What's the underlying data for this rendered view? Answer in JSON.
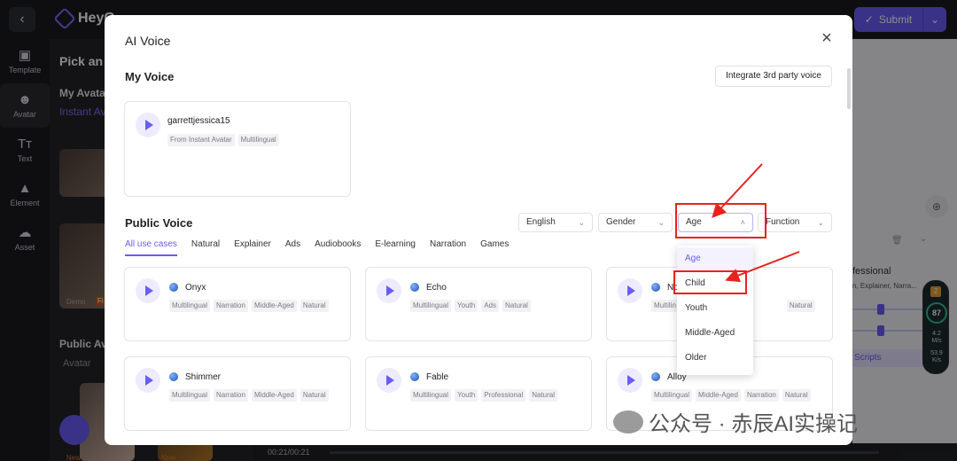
{
  "app": {
    "brand": "HeyG",
    "submit_label": "Submit",
    "sidebar": [
      {
        "label": "Template",
        "icon": "template-icon"
      },
      {
        "label": "Avatar",
        "icon": "avatar-icon"
      },
      {
        "label": "Text",
        "icon": "text-icon"
      },
      {
        "label": "Element",
        "icon": "element-icon"
      },
      {
        "label": "Asset",
        "icon": "asset-icon"
      }
    ],
    "left_panel": {
      "title": "Pick an A",
      "my_avatar": "My Avata",
      "instant_tab": "Instant Av",
      "demo_label": "Demo",
      "fi_label": "Fi",
      "public_title": "Public Av",
      "public_sub": "Avatar",
      "new_label": "New"
    },
    "right_panel": {
      "text1": "fessional",
      "text2": "n, Explainer, Narra...",
      "scripts": "Scripts"
    },
    "timeline_time": "00:21/00:21",
    "perf": {
      "score": "87",
      "up": "4.2",
      "up_unit": "M/s",
      "down": "53.9",
      "down_unit": "K/s",
      "badge": "2"
    }
  },
  "modal": {
    "title": "AI Voice",
    "my_voice_heading": "My Voice",
    "integrate_button": "Integrate 3rd party voice",
    "my_voice_card": {
      "name": "garrettjessica15",
      "tags": [
        "From Instant Avatar",
        "Multilingual"
      ]
    },
    "public_voice_heading": "Public Voice",
    "filters": {
      "language": "English",
      "gender": "Gender",
      "age": "Age",
      "function": "Function"
    },
    "tabs": [
      "All use cases",
      "Natural",
      "Explainer",
      "Ads",
      "Audiobooks",
      "E-learning",
      "Narration",
      "Games"
    ],
    "voices": [
      {
        "name": "Onyx",
        "tags": [
          "Multilingual",
          "Narration",
          "Middle-Aged",
          "Natural"
        ]
      },
      {
        "name": "Echo",
        "tags": [
          "Multilingual",
          "Youth",
          "Ads",
          "Natural"
        ]
      },
      {
        "name": "No",
        "tags": [
          "Multilin",
          "Natural"
        ]
      },
      {
        "name": "Shimmer",
        "tags": [
          "Multilingual",
          "Narration",
          "Middle-Aged",
          "Natural"
        ]
      },
      {
        "name": "Fable",
        "tags": [
          "Multilingual",
          "Youth",
          "Professional",
          "Natural"
        ]
      },
      {
        "name": "Alloy",
        "tags": [
          "Multilingual",
          "Middle-Aged",
          "Narration",
          "Natural"
        ]
      }
    ],
    "age_dropdown": {
      "options": [
        "Age",
        "Child",
        "Youth",
        "Middle-Aged",
        "Older"
      ],
      "highlighted": "Child"
    }
  },
  "watermark": "公众号 · 赤辰AI实操记",
  "colors": {
    "accent": "#6b5cf6",
    "annotation": "#e8221d"
  }
}
